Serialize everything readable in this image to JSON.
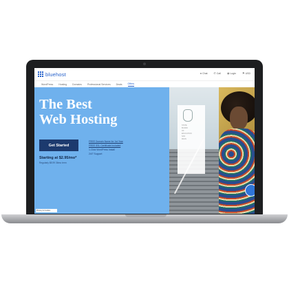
{
  "brand": {
    "name": "bluehost",
    "color": "#1f5cc9"
  },
  "utility_bar": [
    {
      "icon": "chat-icon",
      "label": "Chat"
    },
    {
      "icon": "phone-icon",
      "label": "Call"
    },
    {
      "icon": "user-icon",
      "label": "Login"
    },
    {
      "icon": "flag-icon",
      "label": "USD"
    }
  ],
  "subnav": [
    {
      "label": "WordPress"
    },
    {
      "label": "Hosting"
    },
    {
      "label": "Domains"
    },
    {
      "label": "Professional Services"
    },
    {
      "label": "Deals"
    },
    {
      "label": "Offers",
      "active": true
    }
  ],
  "hero": {
    "title_line1": "The Best",
    "title_line2": "Web Hosting",
    "cta": "Get Started",
    "price": "Starting at $2.95/mo*",
    "price_sub": "Regularly $8.99  36mo term",
    "features": [
      "FREE Domain Name for 1st Year",
      "FREE SSL Certificate Included",
      "1-Click WordPress Install",
      "24/7 Support"
    ],
    "left_color": "#6fb1ed"
  },
  "card": {
    "lines": [
      "STATE",
      "BOARD",
      "OF",
      "EDUCATION",
      "SAN",
      "FRAN"
    ]
  },
  "corner_badge": "Privacy & Cookies"
}
